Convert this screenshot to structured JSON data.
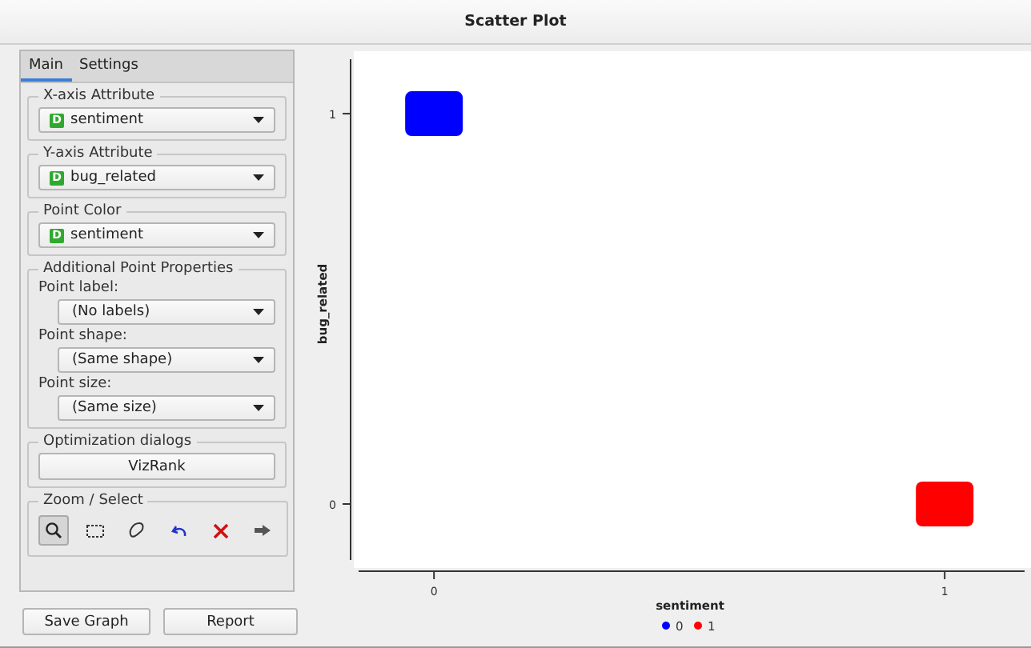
{
  "window": {
    "title": "Scatter Plot"
  },
  "tabs": [
    {
      "label": "Main",
      "selected": true
    },
    {
      "label": "Settings",
      "selected": false
    }
  ],
  "attribute_groups": [
    {
      "title": "X-axis Attribute",
      "badge": "D",
      "value": "sentiment"
    },
    {
      "title": "Y-axis Attribute",
      "badge": "D",
      "value": "bug_related"
    },
    {
      "title": "Point Color",
      "badge": "D",
      "value": "sentiment"
    }
  ],
  "point_properties": {
    "title": "Additional Point Properties",
    "fields": [
      {
        "label": "Point label:",
        "value": "(No labels)"
      },
      {
        "label": "Point shape:",
        "value": "(Same shape)"
      },
      {
        "label": "Point size:",
        "value": "(Same size)"
      }
    ]
  },
  "optimization": {
    "title": "Optimization dialogs",
    "button": "VizRank"
  },
  "zoom_select": {
    "title": "Zoom / Select",
    "tools": [
      {
        "kind": "zoom",
        "selected": true
      },
      {
        "kind": "rectangle",
        "selected": false
      },
      {
        "kind": "lasso",
        "selected": false
      },
      {
        "kind": "undo",
        "selected": false
      },
      {
        "kind": "remove",
        "selected": false
      },
      {
        "kind": "send",
        "selected": false
      }
    ]
  },
  "buttons": [
    "Save Graph",
    "Report"
  ],
  "plot": {
    "chart_data": {
      "type": "scatter",
      "xlabel": "sentiment",
      "ylabel": "bug_related",
      "xticks": [
        0,
        1
      ],
      "yticks": [
        0,
        1
      ],
      "xlim": [
        -0.157,
        1.169
      ],
      "ylim": [
        -0.164,
        1.16
      ],
      "legend": "bottom",
      "series": [
        {
          "name": "0",
          "color": "#0000ff",
          "x": [
            0
          ],
          "values": [
            1
          ]
        },
        {
          "name": "1",
          "color": "#ff0000",
          "x": [
            1
          ],
          "values": [
            0
          ]
        }
      ]
    }
  }
}
